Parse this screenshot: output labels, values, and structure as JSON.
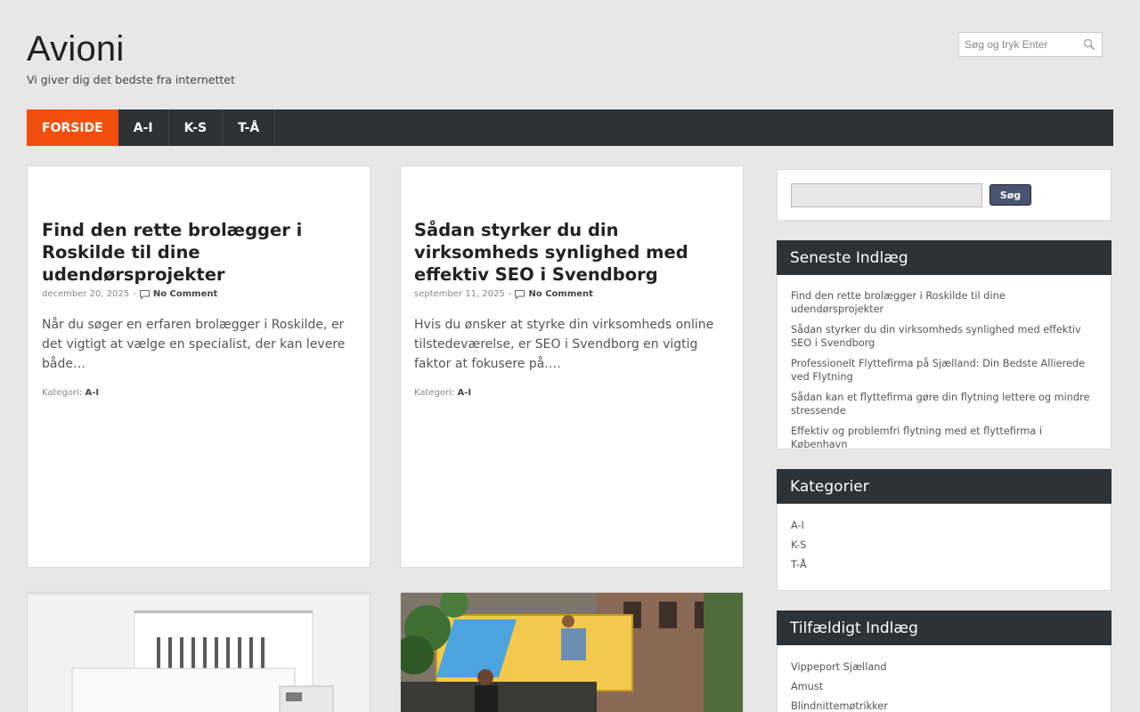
{
  "site": {
    "title": "Avioni",
    "tagline": "Vi giver dig det bedste fra internettet"
  },
  "header_search": {
    "placeholder": "Søg og tryk Enter",
    "icon": "search-icon"
  },
  "nav": {
    "items": [
      {
        "label": "FORSIDE",
        "active": true
      },
      {
        "label": "A-I"
      },
      {
        "label": "K-S"
      },
      {
        "label": "T-Å"
      }
    ]
  },
  "posts": [
    {
      "title": "Find den rette brolægger i Roskilde til dine udendørsprojekter",
      "date": "december 20, 2025",
      "comments": "No Comment",
      "excerpt": "Når du søger en erfaren brolægger i Roskilde, er det vigtigt at vælge en specialist, der kan levere både…",
      "category_label": "Kategori:",
      "category": "A-I"
    },
    {
      "title": "Sådan styrker du din virksomheds synlighed med effektiv SEO i Svendborg",
      "date": "september 11, 2025",
      "comments": "No Comment",
      "excerpt": "Hvis du ønsker at styrke din virksomheds online tilstedeværelse, er SEO i Svendborg en vigtig faktor at fokusere på.…",
      "category_label": "Kategori:",
      "category": "A-I"
    }
  ],
  "sidebar": {
    "search": {
      "button_label": "Søg",
      "value": ""
    },
    "recent": {
      "title": "Seneste Indlæg",
      "items": [
        "Find den rette brolægger i Roskilde til dine udendørsprojekter",
        "Sådan styrker du din virksomheds synlighed med effektiv SEO i Svendborg",
        "Professionelt Flyttefirma på Sjælland: Din Bedste Allierede ved Flytning",
        "Sådan kan et flyttefirma gøre din flytning lettere og mindre stressende",
        "Effektiv og problemfri flytning med et flyttefirma i København"
      ]
    },
    "categories": {
      "title": "Kategorier",
      "items": [
        "A-I",
        "K-S",
        "T-Å"
      ]
    },
    "random": {
      "title": "Tilfældigt Indlæg",
      "items": [
        "Vippeport Sjælland",
        "Amust",
        "Blindnittemøtrikker"
      ]
    }
  },
  "colors": {
    "accent": "#f24f0f",
    "nav_bg": "#2d3236",
    "page_bg": "#e7e7e7",
    "button": "#4a5470"
  }
}
